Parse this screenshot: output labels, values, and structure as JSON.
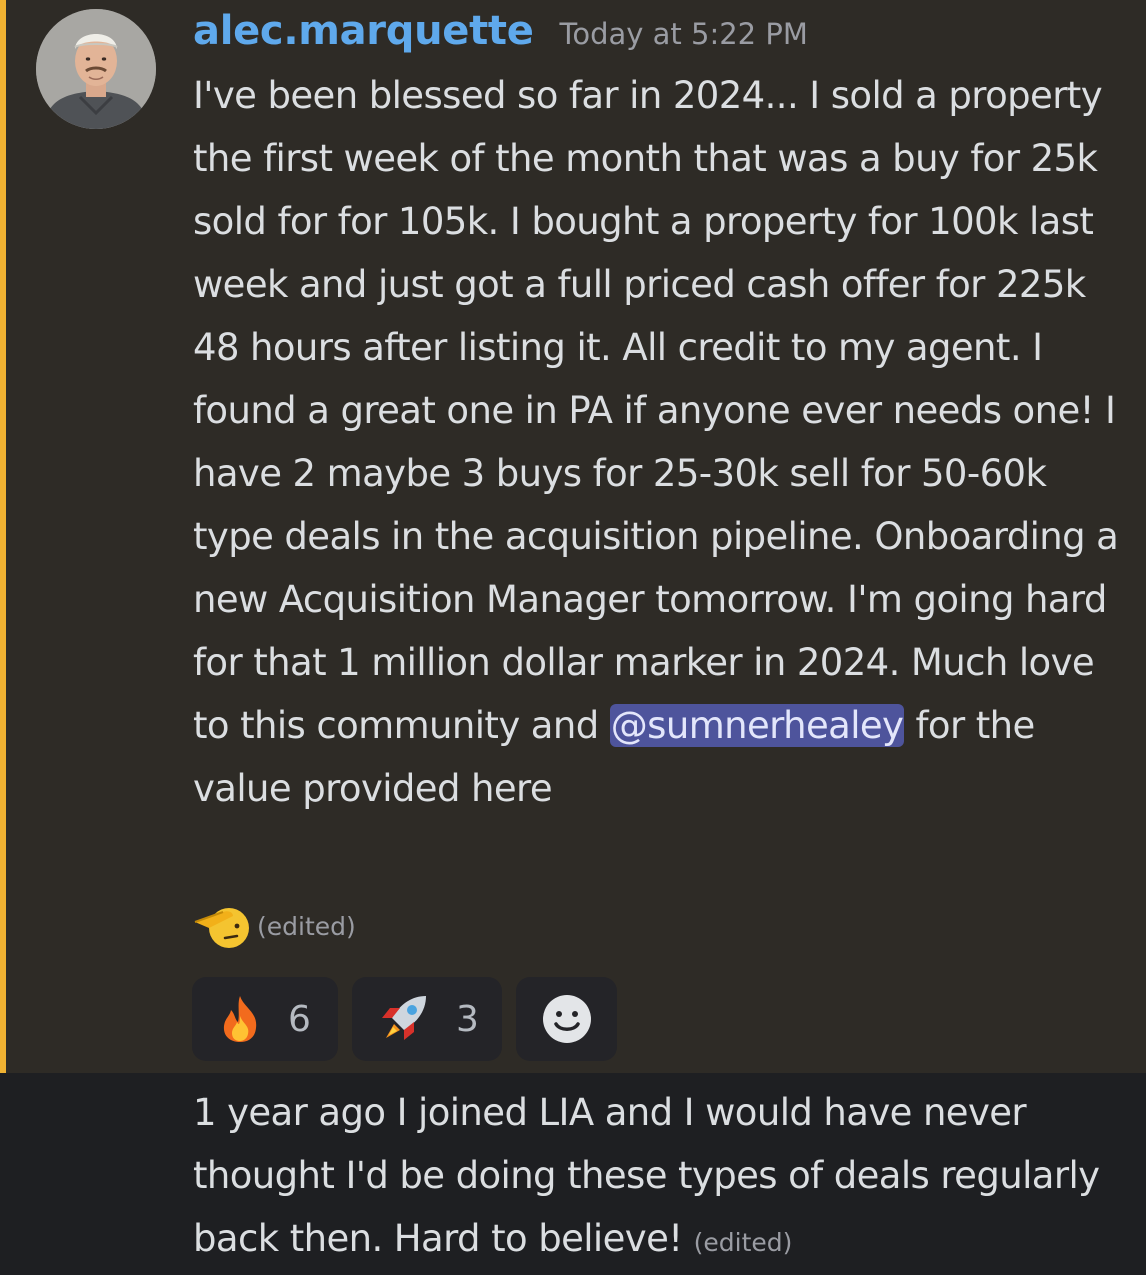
{
  "colors": {
    "background": "#1e1f22",
    "message_highlight": "#2e2b26",
    "mention_bar": "#f0b232",
    "username": "#5fa9ec",
    "mention_bg": "#4e549c",
    "reaction_bg": "#242428"
  },
  "message": {
    "username": "alec.marquette",
    "timestamp": "Today at 5:22 PM",
    "avatar_icon": "user-avatar",
    "text_before_mention": "I've been blessed so far in 2024... I sold a property the first week of the month that was a buy for 25k sold for for 105k. I bought a property for 100k last week and just got a full priced cash offer for 225k 48 hours after listing it. All credit to my agent. I found a great one in PA if anyone ever needs one! I have 2 maybe 3 buys for 25-30k sell for 50-60k type deals in the acquisition pipeline. Onboarding a new Acquisition Manager tomorrow. I'm going hard  for that 1 million dollar marker in 2024. Much love to this community and ",
    "mention": "@sumnerhealey",
    "text_after_mention": " for the value provided here",
    "trailing_emoji": "saluting-face-emoji",
    "edited": "(edited)",
    "reactions": [
      {
        "emoji": "fire-emoji",
        "count": "6"
      },
      {
        "emoji": "rocket-emoji",
        "count": "3"
      }
    ],
    "add_reaction_icon": "add-reaction-smiley-icon"
  },
  "followup": {
    "text": "1 year ago I joined LIA and I would have never thought I'd be doing these types of deals regularly back then. Hard to believe!",
    "edited": "(edited)"
  }
}
